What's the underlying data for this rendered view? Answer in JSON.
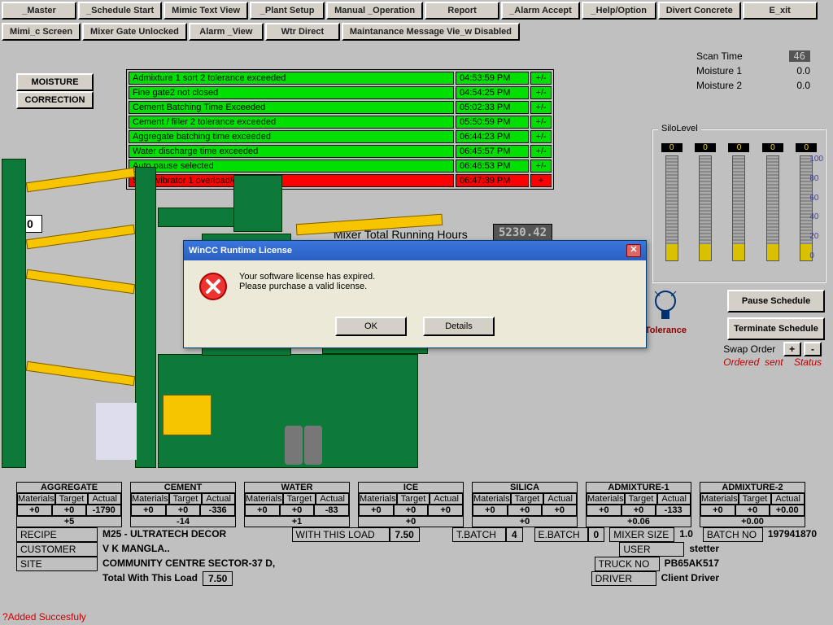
{
  "menubar": {
    "row1": [
      "_Master",
      "_Schedule Start",
      "Mimic Text View",
      "_Plant Setup",
      "Manual _Operation",
      "Report",
      "_Alarm Accept",
      "_Help/Option",
      "Divert Concrete",
      "E_xit"
    ],
    "row2": [
      "Mimi_c Screen",
      "Mixer Gate Unlocked",
      "Alarm _View",
      "Wtr Direct",
      "Maintanance Message Vie_w Disabled"
    ]
  },
  "moisture": {
    "line1": "MOISTURE",
    "line2": "CORRECTION"
  },
  "alarms": [
    {
      "msg": "Admixture 1 sort 2 tolerance exceeded",
      "time": "04:53:59 PM",
      "flag": "+/-",
      "sev": "green"
    },
    {
      "msg": "Fine gate2 not closed",
      "time": "04:54:25 PM",
      "flag": "+/-",
      "sev": "green"
    },
    {
      "msg": "Cement Batching Time Exceeded",
      "time": "05:02:33 PM",
      "flag": "+/-",
      "sev": "green"
    },
    {
      "msg": "Cement / filler 2 tolerance exceeded",
      "time": "05:50:59 PM",
      "flag": "+/-",
      "sev": "green"
    },
    {
      "msg": "Aggregate batching time exceeded",
      "time": "06:44:23 PM",
      "flag": "+/-",
      "sev": "green"
    },
    {
      "msg": "Water discharge time exceeded",
      "time": "06:45:57 PM",
      "flag": "+/-",
      "sev": "green"
    },
    {
      "msg": "Auto pause selected",
      "time": "06:46:53 PM",
      "flag": "+/-",
      "sev": "green"
    },
    {
      "msg": "Sand vibrator 1 overload/off/trip",
      "time": "06:47:39 PM",
      "flag": "+",
      "sev": "red"
    }
  ],
  "scan": {
    "label": "Scan Time",
    "value": "46",
    "m1_label": "Moisture 1",
    "m1_val": "0.0",
    "m2_label": "Moisture 2",
    "m2_val": "0.0"
  },
  "silo": {
    "title": "SiloLevel",
    "vals": [
      "0",
      "0",
      "0",
      "0",
      "0"
    ],
    "scale": [
      "100",
      "80",
      "60",
      "40",
      "20",
      "0"
    ]
  },
  "bulb_label": "Tolerance",
  "right_btns": {
    "pause": "Pause Schedule",
    "term": "Terminate Schedule"
  },
  "swap": {
    "label": "Swap Order",
    "plus": "+",
    "minus": "-",
    "ordered": "Ordered",
    "sent": "sent",
    "status": "Status"
  },
  "mixer": {
    "label": "Mixer Total Running Hours",
    "value": "5230.42"
  },
  "counter": "0",
  "materials": [
    {
      "name": "AGGREGATE",
      "h": [
        "Materials",
        "Target",
        "Actual"
      ],
      "v": [
        "+0",
        "+0",
        "-1790"
      ],
      "total": "+5"
    },
    {
      "name": "CEMENT",
      "h": [
        "Materials",
        "Target",
        "Actual"
      ],
      "v": [
        "+0",
        "+0",
        "-336"
      ],
      "total": "-14"
    },
    {
      "name": "WATER",
      "h": [
        "Materials",
        "Target",
        "Actual"
      ],
      "v": [
        "+0",
        "+0",
        "-83"
      ],
      "total": "+1"
    },
    {
      "name": "ICE",
      "h": [
        "Materials",
        "Target",
        "Actual"
      ],
      "v": [
        "+0",
        "+0",
        "+0"
      ],
      "total": "+0"
    },
    {
      "name": "SILICA",
      "h": [
        "Materials",
        "Target",
        "Actual"
      ],
      "v": [
        "+0",
        "+0",
        "+0"
      ],
      "total": "+0"
    },
    {
      "name": "ADMIXTURE-1",
      "h": [
        "Materials",
        "Target",
        "Actual"
      ],
      "v": [
        "+0",
        "+0",
        "-133"
      ],
      "total": "+0.06"
    },
    {
      "name": "ADMIXTURE-2",
      "h": [
        "Materials",
        "Target",
        "Actual"
      ],
      "v": [
        "+0",
        "+0",
        "+0.00"
      ],
      "total": "+0.00"
    }
  ],
  "info": {
    "recipe_l": "RECIPE",
    "recipe_v": "M25 - ULTRATECH DECOR",
    "wtl_l": "WITH THIS LOAD",
    "wtl_v": "7.50",
    "tbatch_l": "T.BATCH",
    "tbatch_v": "4",
    "ebatch_l": "E.BATCH",
    "ebatch_v": "0",
    "mixsize_l": "MIXER SIZE",
    "mixsize_v": "1.0",
    "batchno_l": "BATCH NO",
    "batchno_v": "197941870",
    "cust_l": "CUSTOMER",
    "cust_v": "V K MANGLA..",
    "user_l": "USER",
    "user_v": "stetter",
    "site_l": "SITE",
    "site_v": "COMMUNITY CENTRE SECTOR-37 D,",
    "truck_l": "TRUCK NO",
    "truck_v": "PB65AK517",
    "twl_l": "Total With This Load",
    "twl_v": "7.50",
    "driver_l": "DRIVER",
    "driver_v": "Client Driver"
  },
  "bottom_msg": "?Added Succesfuly",
  "dialog": {
    "title": "WinCC Runtime License",
    "line1": "Your software license has expired.",
    "line2": "Please purchase a valid license.",
    "ok": "OK",
    "details": "Details"
  }
}
